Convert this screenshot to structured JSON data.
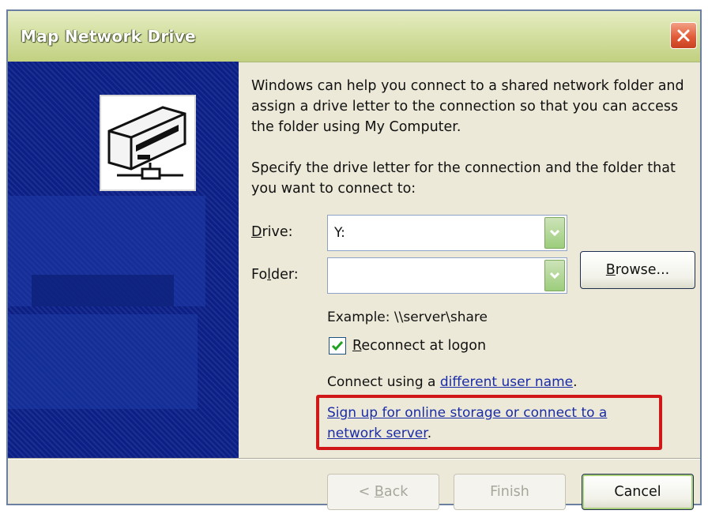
{
  "window": {
    "title": "Map Network Drive"
  },
  "intro": {
    "text": "Windows can help you connect to a shared network folder and assign a drive letter to the connection so that you can access the folder using My Computer."
  },
  "instructions": {
    "text": "Specify the drive letter for the connection and the folder that you want to connect to:"
  },
  "drive": {
    "label_pre": "",
    "label_accel": "D",
    "label_post": "rive:",
    "value": "Y:"
  },
  "folder": {
    "label_pre": "Fo",
    "label_accel": "l",
    "label_post": "der:",
    "value": ""
  },
  "browse": {
    "label_pre": "",
    "label_accel": "B",
    "label_post": "rowse..."
  },
  "example": {
    "text": "Example: \\\\server\\share"
  },
  "reconnect": {
    "checked": true,
    "label_pre": "",
    "label_accel": "R",
    "label_post": "econnect at logon"
  },
  "connect_using": {
    "prefix": "Connect using a ",
    "link": "different user name",
    "suffix": "."
  },
  "signup": {
    "link": "Sign up for online storage or connect to a network server",
    "suffix": "."
  },
  "buttons": {
    "back": {
      "label_pre": "< ",
      "label_accel": "B",
      "label_post": "ack",
      "enabled": false
    },
    "finish": {
      "label": "Finish",
      "enabled": false
    },
    "cancel": {
      "label": "Cancel",
      "enabled": true
    }
  },
  "colors": {
    "titlebar": "#c2d081",
    "side_panel": "#0c1f86",
    "highlight_box": "#d01818",
    "link": "#1a2ca8",
    "dialog_background": "#ece9d8"
  },
  "icons": [
    "network-drive-icon",
    "close-icon",
    "chevron-down-icon",
    "checkmark-icon"
  ]
}
